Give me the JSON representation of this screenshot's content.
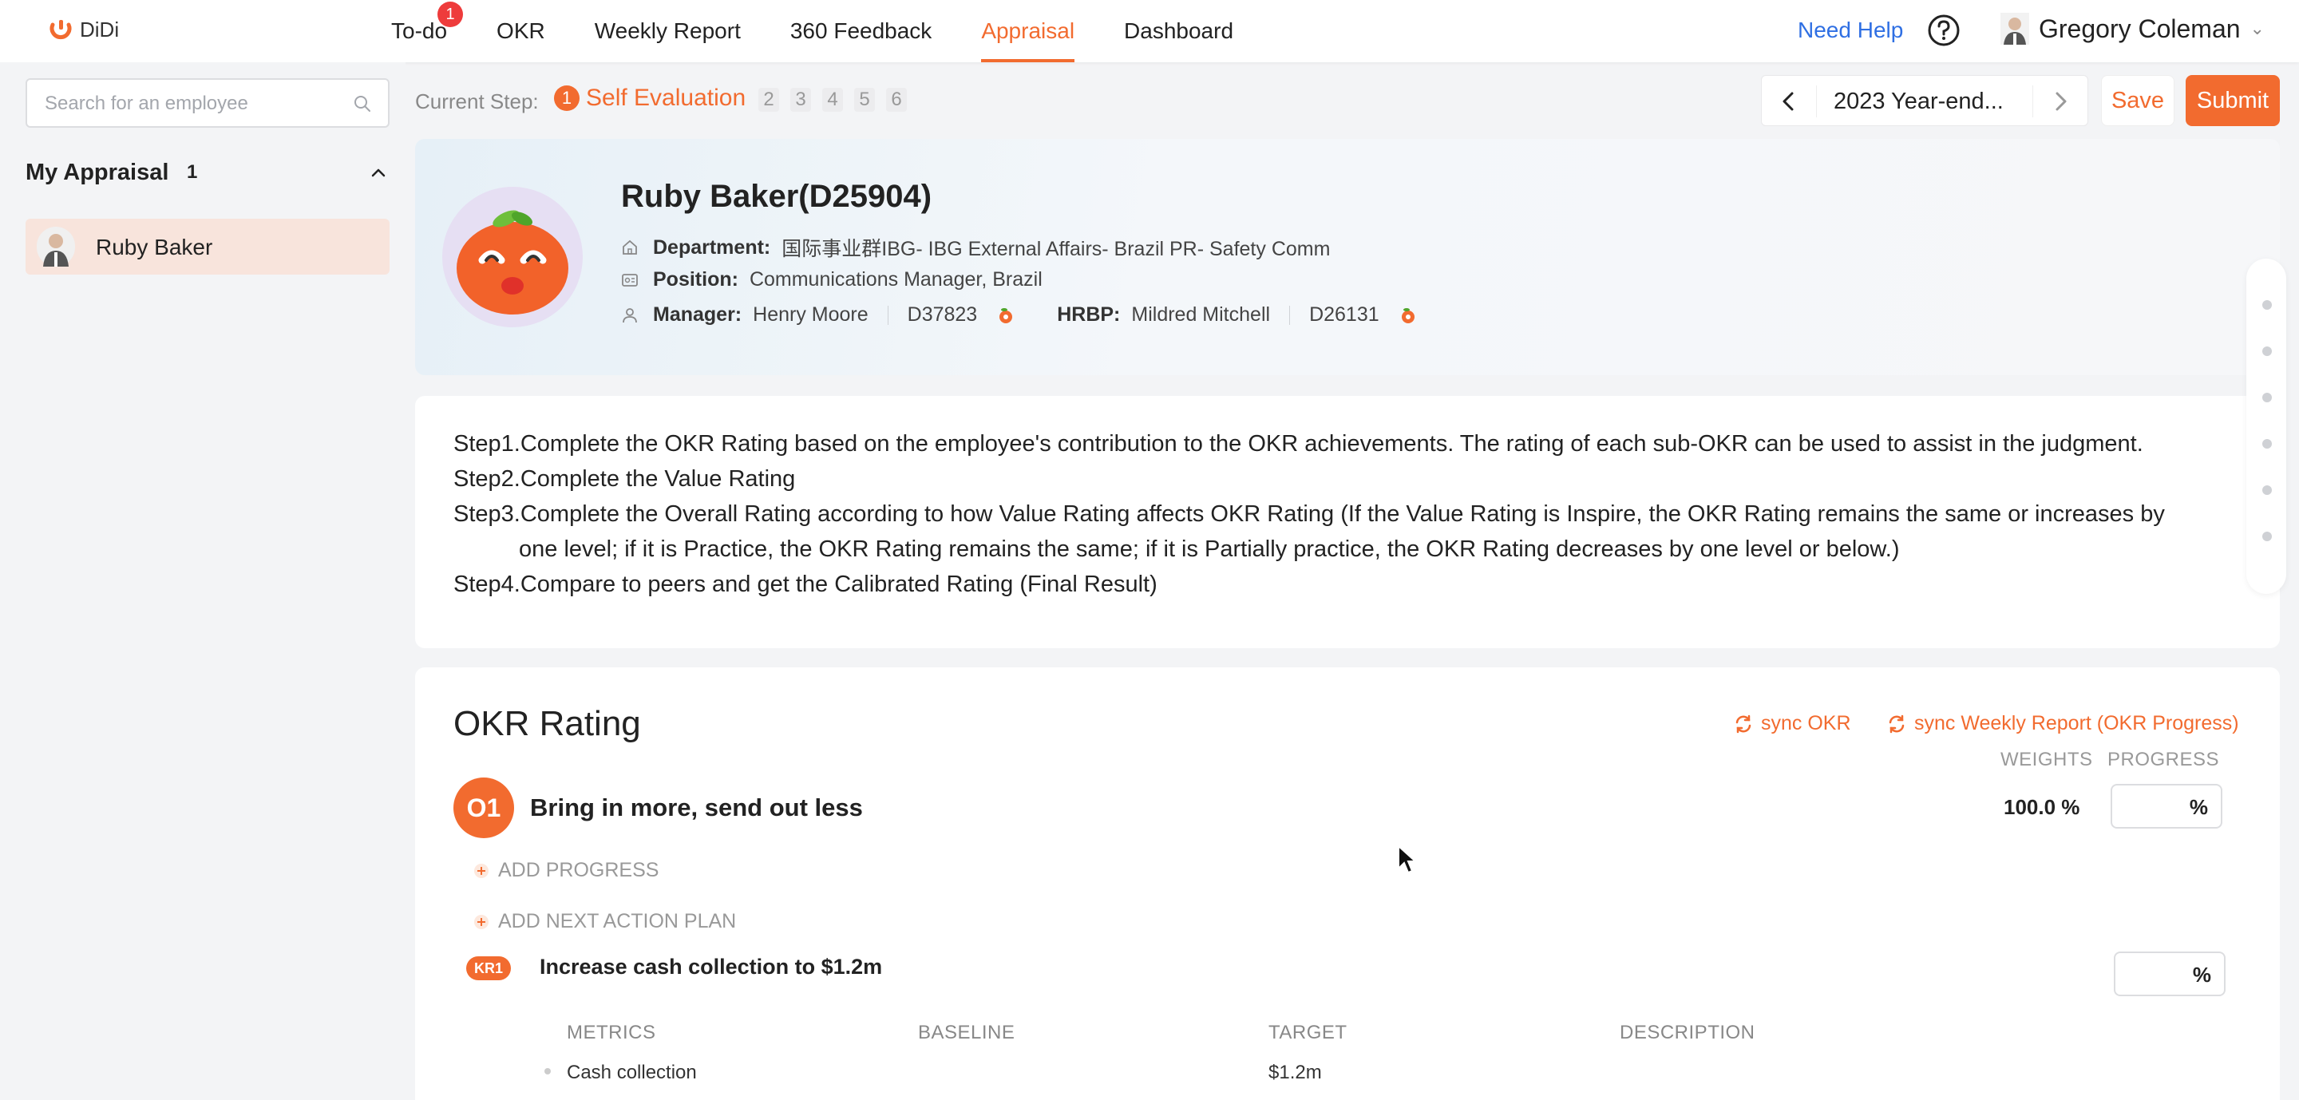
{
  "app": {
    "logo_text": "DiDi"
  },
  "nav": {
    "items": [
      {
        "label": "To-do",
        "badge": "1"
      },
      {
        "label": "OKR"
      },
      {
        "label": "Weekly Report"
      },
      {
        "label": "360 Feedback"
      },
      {
        "label": "Appraisal",
        "active": true
      },
      {
        "label": "Dashboard"
      }
    ],
    "need_help": "Need Help",
    "user_name": "Gregory Coleman"
  },
  "sidebar": {
    "search_placeholder": "Search for an employee",
    "section_title": "My Appraisal",
    "section_count": "1",
    "employees": [
      {
        "name": "Ruby Baker"
      }
    ]
  },
  "steps_bar": {
    "label": "Current Step:",
    "active_num": "1",
    "active_label": "Self Evaluation",
    "others": [
      "2",
      "3",
      "4",
      "5",
      "6"
    ]
  },
  "period": {
    "label": "2023 Year-end..."
  },
  "actions": {
    "save": "Save",
    "submit": "Submit"
  },
  "profile": {
    "name": "Ruby Baker(D25904)",
    "department_label": "Department:",
    "department_value": "国际事业群IBG- IBG External Affairs- Brazil PR- Safety Comm",
    "position_label": "Position:",
    "position_value": "Communications Manager, Brazil",
    "manager_label": "Manager:",
    "manager_name": "Henry Moore",
    "manager_id": "D37823",
    "hrbp_label": "HRBP:",
    "hrbp_name": "Mildred Mitchell",
    "hrbp_id": "D26131"
  },
  "instructions": {
    "step1": "Step1.Complete the OKR Rating based on the employee's contribution to the OKR achievements. The rating of each sub-OKR can be used to assist in the judgment.",
    "step2": "Step2.Complete the Value Rating",
    "step3a": "Step3.Complete the Overall Rating according to how Value Rating affects OKR Rating (If the Value Rating is Inspire, the OKR Rating remains the same or increases by",
    "step3b": "one level; if it is Practice, the OKR Rating remains the same; if it is Partially practice, the OKR Rating decreases by one level or below.)",
    "step4": "Step4.Compare to peers and get the Calibrated Rating (Final Result)"
  },
  "okr": {
    "title": "OKR Rating",
    "sync_okr": "sync OKR",
    "sync_weekly": "sync Weekly Report (OKR Progress)",
    "col_weights": "WEIGHTS",
    "col_progress": "PROGRESS",
    "objective": {
      "badge": "O1",
      "title": "Bring in more, send out less",
      "weight": "100.0 %",
      "pct_symbol": "%"
    },
    "add_progress": "ADD PROGRESS",
    "add_next_action": "ADD NEXT ACTION PLAN",
    "kr": {
      "badge": "KR1",
      "title": "Increase cash collection to $1.2m",
      "pct_symbol": "%"
    },
    "metrics_headers": {
      "metrics": "METRICS",
      "baseline": "BASELINE",
      "target": "TARGET",
      "description": "DESCRIPTION"
    },
    "metrics_row": {
      "metric": "Cash collection",
      "baseline": "",
      "target": "$1.2m",
      "description": ""
    }
  },
  "colors": {
    "accent": "#f26b2f",
    "link": "#2f6fe3",
    "badge_red": "#ee3b3b"
  }
}
